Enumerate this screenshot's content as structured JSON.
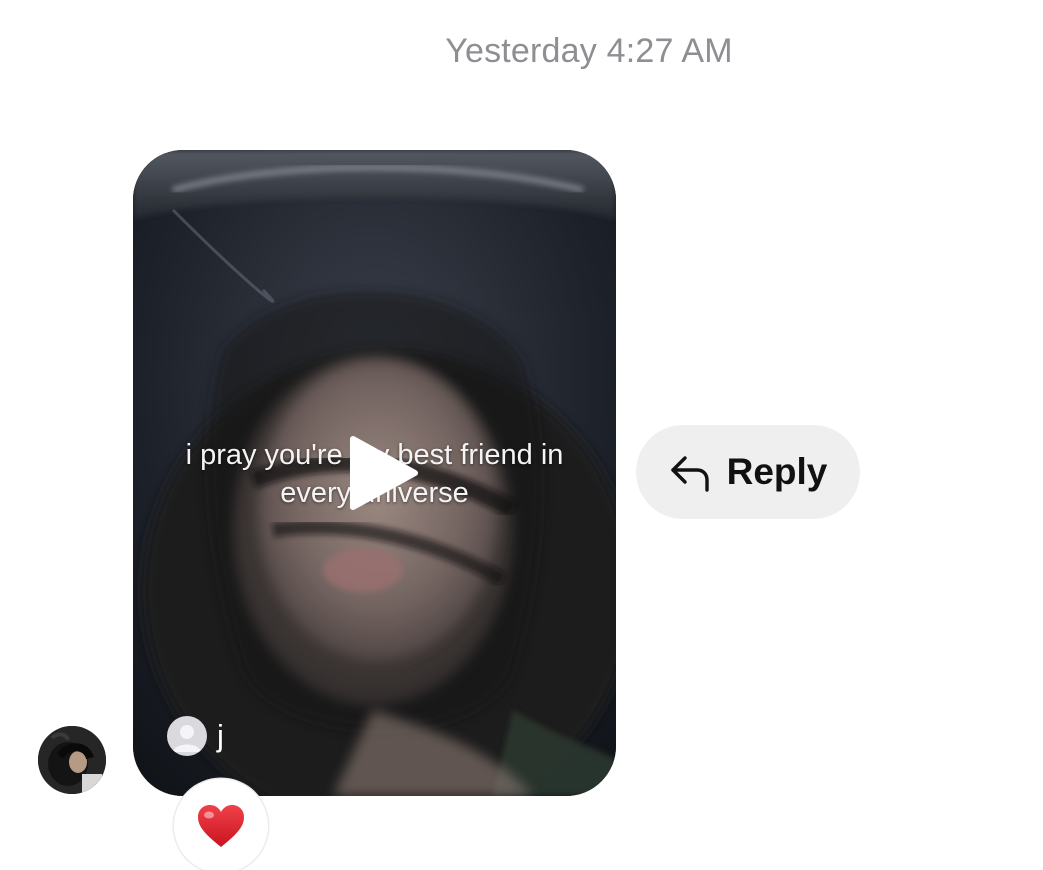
{
  "thread": {
    "timestamp": "Yesterday 4:27 AM"
  },
  "message": {
    "video": {
      "caption_line1": "i pray you're my best friend in",
      "caption_line2": "every universe",
      "sender_name": "j",
      "play_icon": "play-icon"
    },
    "reaction": {
      "emoji": "heart-icon",
      "color": "#e0202b"
    }
  },
  "reply": {
    "label": "Reply",
    "icon": "reply-arrow-icon"
  }
}
